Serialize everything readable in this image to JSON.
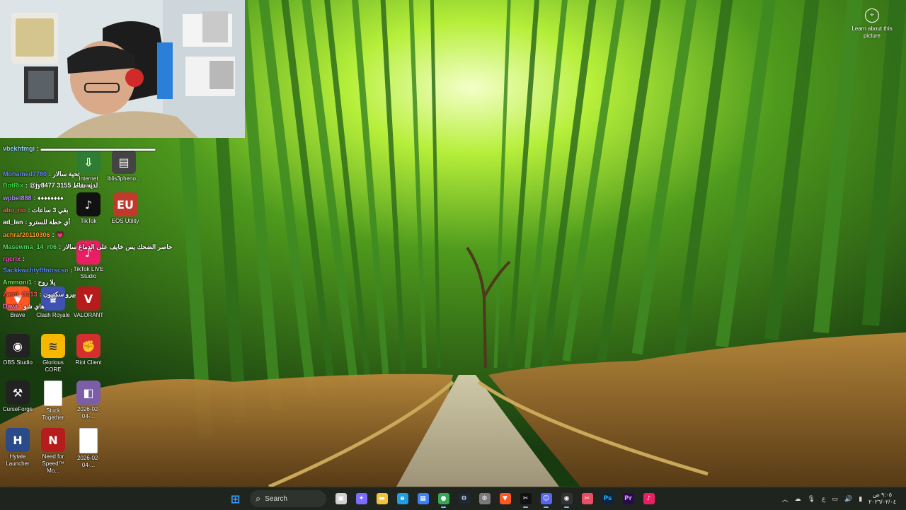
{
  "learn_about": {
    "label": "Learn about this picture",
    "icon": "camera-lens-icon"
  },
  "chat": [
    {
      "user": "vbekhfmgi",
      "text": ": ‏▬▬▬▬▬▬▬▬▬▬▬▬▬▬▬▬▬▬",
      "color": "#9ad5ff"
    },
    {
      "user": "Mohamed7780",
      "text": ": تحية سالار",
      "color": "#6c8cff"
    },
    {
      "user": "BotRix",
      "text": ": @jy8477 3155 لديه نقاط",
      "color": "#43e04a"
    },
    {
      "user": "wpbel888",
      "text": ": ♦♦♦♦♦♦♦♦",
      "color": "#b58cff"
    },
    {
      "user": "abo_rio",
      "text": ": بقي 3 ساعات",
      "color": "#ff6464"
    },
    {
      "user": "ad_lan",
      "text": ": أي خطة للسترو",
      "color": "#ffffff"
    },
    {
      "user": "achraf20110306",
      "text": ": 💗",
      "color": "#ff9d2e"
    },
    {
      "user": "Masewma_14_r06",
      "text": ": حاصر الضحك يس خايف على الدماغ سالار",
      "color": "#5bdc6a"
    },
    {
      "user": "rgcrix",
      "text": ": ",
      "color": "#ff4fd0"
    },
    {
      "user": "Sackkwchtyflfntrscsn",
      "text": ": ",
      "color": "#5b8bff"
    },
    {
      "user": "Ammoni1",
      "text": ": يلا روح",
      "color": "#75e04d"
    },
    {
      "user": "Zaroi_C313",
      "text": ": بيرو سكتيون",
      "color": "#ff5a5a"
    },
    {
      "user": "Dawi",
      "text": ": هاي شو",
      "color": "#ff7ad9"
    }
  ],
  "desktop_icons": [
    {
      "label": "Internet Downlo...",
      "icon": "idm-icon",
      "color": "#2f7d32"
    },
    {
      "label": "iblis3pheno...",
      "icon": "folder-icon",
      "color": "#444444"
    },
    {
      "label": "TikTok",
      "icon": "tiktok-icon",
      "color": "#111111"
    },
    {
      "label": "EOS Utility",
      "icon": "eos-utility-icon",
      "color": "#c0392b"
    },
    {
      "label": "TikTok LIVE Studio",
      "icon": "tiktok-live-icon",
      "color": "#e91e63"
    },
    {
      "label": "Brave",
      "icon": "brave-icon",
      "color": "#ff5722"
    },
    {
      "label": "Clash Royale",
      "icon": "clash-royale-icon",
      "color": "#3f51b5"
    },
    {
      "label": "VALORANT",
      "icon": "valorant-icon",
      "color": "#b71c1c"
    },
    {
      "label": "OBS Studio",
      "icon": "obs-icon",
      "color": "#222222"
    },
    {
      "label": "Glorious CORE",
      "icon": "glorious-icon",
      "color": "#f5b700"
    },
    {
      "label": "Riot Client",
      "icon": "riot-icon",
      "color": "#d32f2f"
    },
    {
      "label": "CurseForge",
      "icon": "curseforge-icon",
      "color": "#222222"
    },
    {
      "label": "Stuck Together",
      "icon": "document-icon",
      "color": "#ffffff"
    },
    {
      "label": "2026-02-04-...",
      "icon": "image-file-icon",
      "color": "#7b5ea7"
    },
    {
      "label": "Hytale Launcher",
      "icon": "hytale-icon",
      "color": "#2b4a8a"
    },
    {
      "label": "Need for Speed™ Mo...",
      "icon": "nfs-icon",
      "color": "#b71c1c"
    },
    {
      "label": "2026-02-04-...",
      "icon": "document-icon",
      "color": "#ffffff"
    }
  ],
  "taskbar": {
    "search_label": "Search",
    "apps": [
      {
        "name": "start",
        "icon": "windows-icon",
        "color": "#3aa0ff"
      },
      {
        "name": "search",
        "icon": "search-icon"
      },
      {
        "name": "task-view",
        "icon": "task-view-icon",
        "color": "#d0d0d0"
      },
      {
        "name": "copilot",
        "icon": "copilot-icon",
        "color": "#7c6cff"
      },
      {
        "name": "file-explorer",
        "icon": "folder-icon",
        "color": "#f0c33c"
      },
      {
        "name": "edge",
        "icon": "edge-icon",
        "color": "#1f9ee0"
      },
      {
        "name": "store",
        "icon": "store-icon",
        "color": "#3b82f6"
      },
      {
        "name": "chrome",
        "icon": "chrome-icon",
        "color": "#34a853"
      },
      {
        "name": "steam",
        "icon": "steam-icon",
        "color": "#1b2838"
      },
      {
        "name": "settings",
        "icon": "gear-icon",
        "color": "#7a7a7a"
      },
      {
        "name": "brave",
        "icon": "brave-icon",
        "color": "#ff5722"
      },
      {
        "name": "capcut",
        "icon": "capcut-icon",
        "color": "#111111"
      },
      {
        "name": "discord",
        "icon": "discord-icon",
        "color": "#5865f2"
      },
      {
        "name": "obs",
        "icon": "obs-icon",
        "color": "#333333"
      },
      {
        "name": "snipping",
        "icon": "snipping-tool-icon",
        "color": "#e94f64"
      },
      {
        "name": "photoshop",
        "icon": "photoshop-icon",
        "color": "#0a2540"
      },
      {
        "name": "premiere",
        "icon": "premiere-icon",
        "color": "#2a0a4a"
      },
      {
        "name": "tiktok-studio",
        "icon": "tiktok-live-icon",
        "color": "#e91e63"
      }
    ],
    "tray": {
      "lang": "ع",
      "time": "٩:٠٥ ص",
      "date": "٢٠٢٦/٠٢/٠٤"
    }
  }
}
